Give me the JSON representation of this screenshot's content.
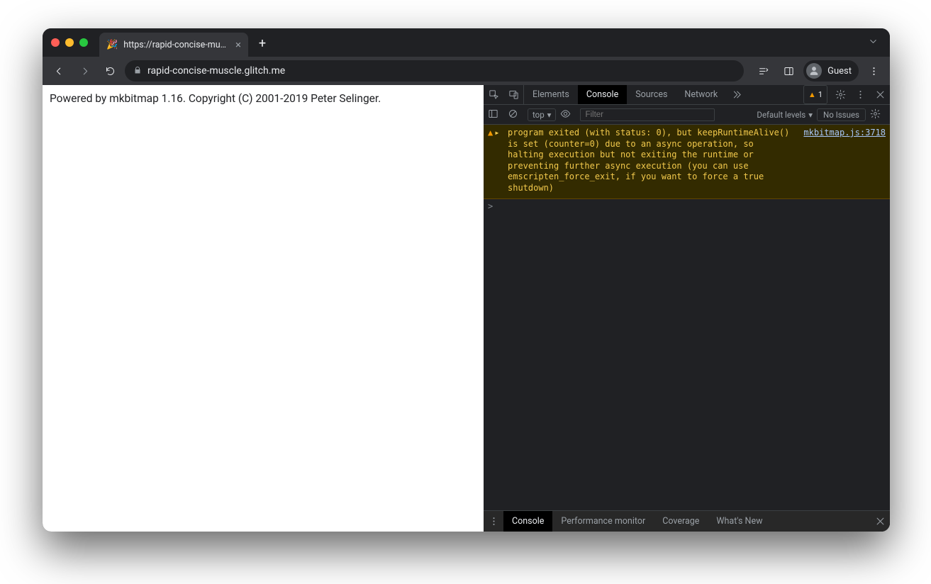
{
  "tab": {
    "title": "https://rapid-concise-muscle.g",
    "favicon": "🎉"
  },
  "omnibox": {
    "url": "rapid-concise-muscle.glitch.me"
  },
  "profile": {
    "label": "Guest"
  },
  "page": {
    "body_text": "Powered by mkbitmap 1.16. Copyright (C) 2001-2019 Peter Selinger."
  },
  "devtools": {
    "tabs": {
      "elements": "Elements",
      "console": "Console",
      "sources": "Sources",
      "network": "Network"
    },
    "warnings_count": "1",
    "toolbar": {
      "context": "top",
      "filter_placeholder": "Filter",
      "levels_label": "Default levels",
      "no_issues": "No Issues"
    },
    "console": {
      "warning_message": "program exited (with status: 0), but keepRuntimeAlive() is set (counter=0) due to an async operation, so halting execution but not exiting the runtime or preventing further async execution (you can use emscripten_force_exit, if you want to force a true shutdown)",
      "warning_source": "mkbitmap.js:3718",
      "prompt": ">"
    },
    "drawer": {
      "console": "Console",
      "performance_monitor": "Performance monitor",
      "coverage": "Coverage",
      "whats_new": "What's New"
    }
  }
}
